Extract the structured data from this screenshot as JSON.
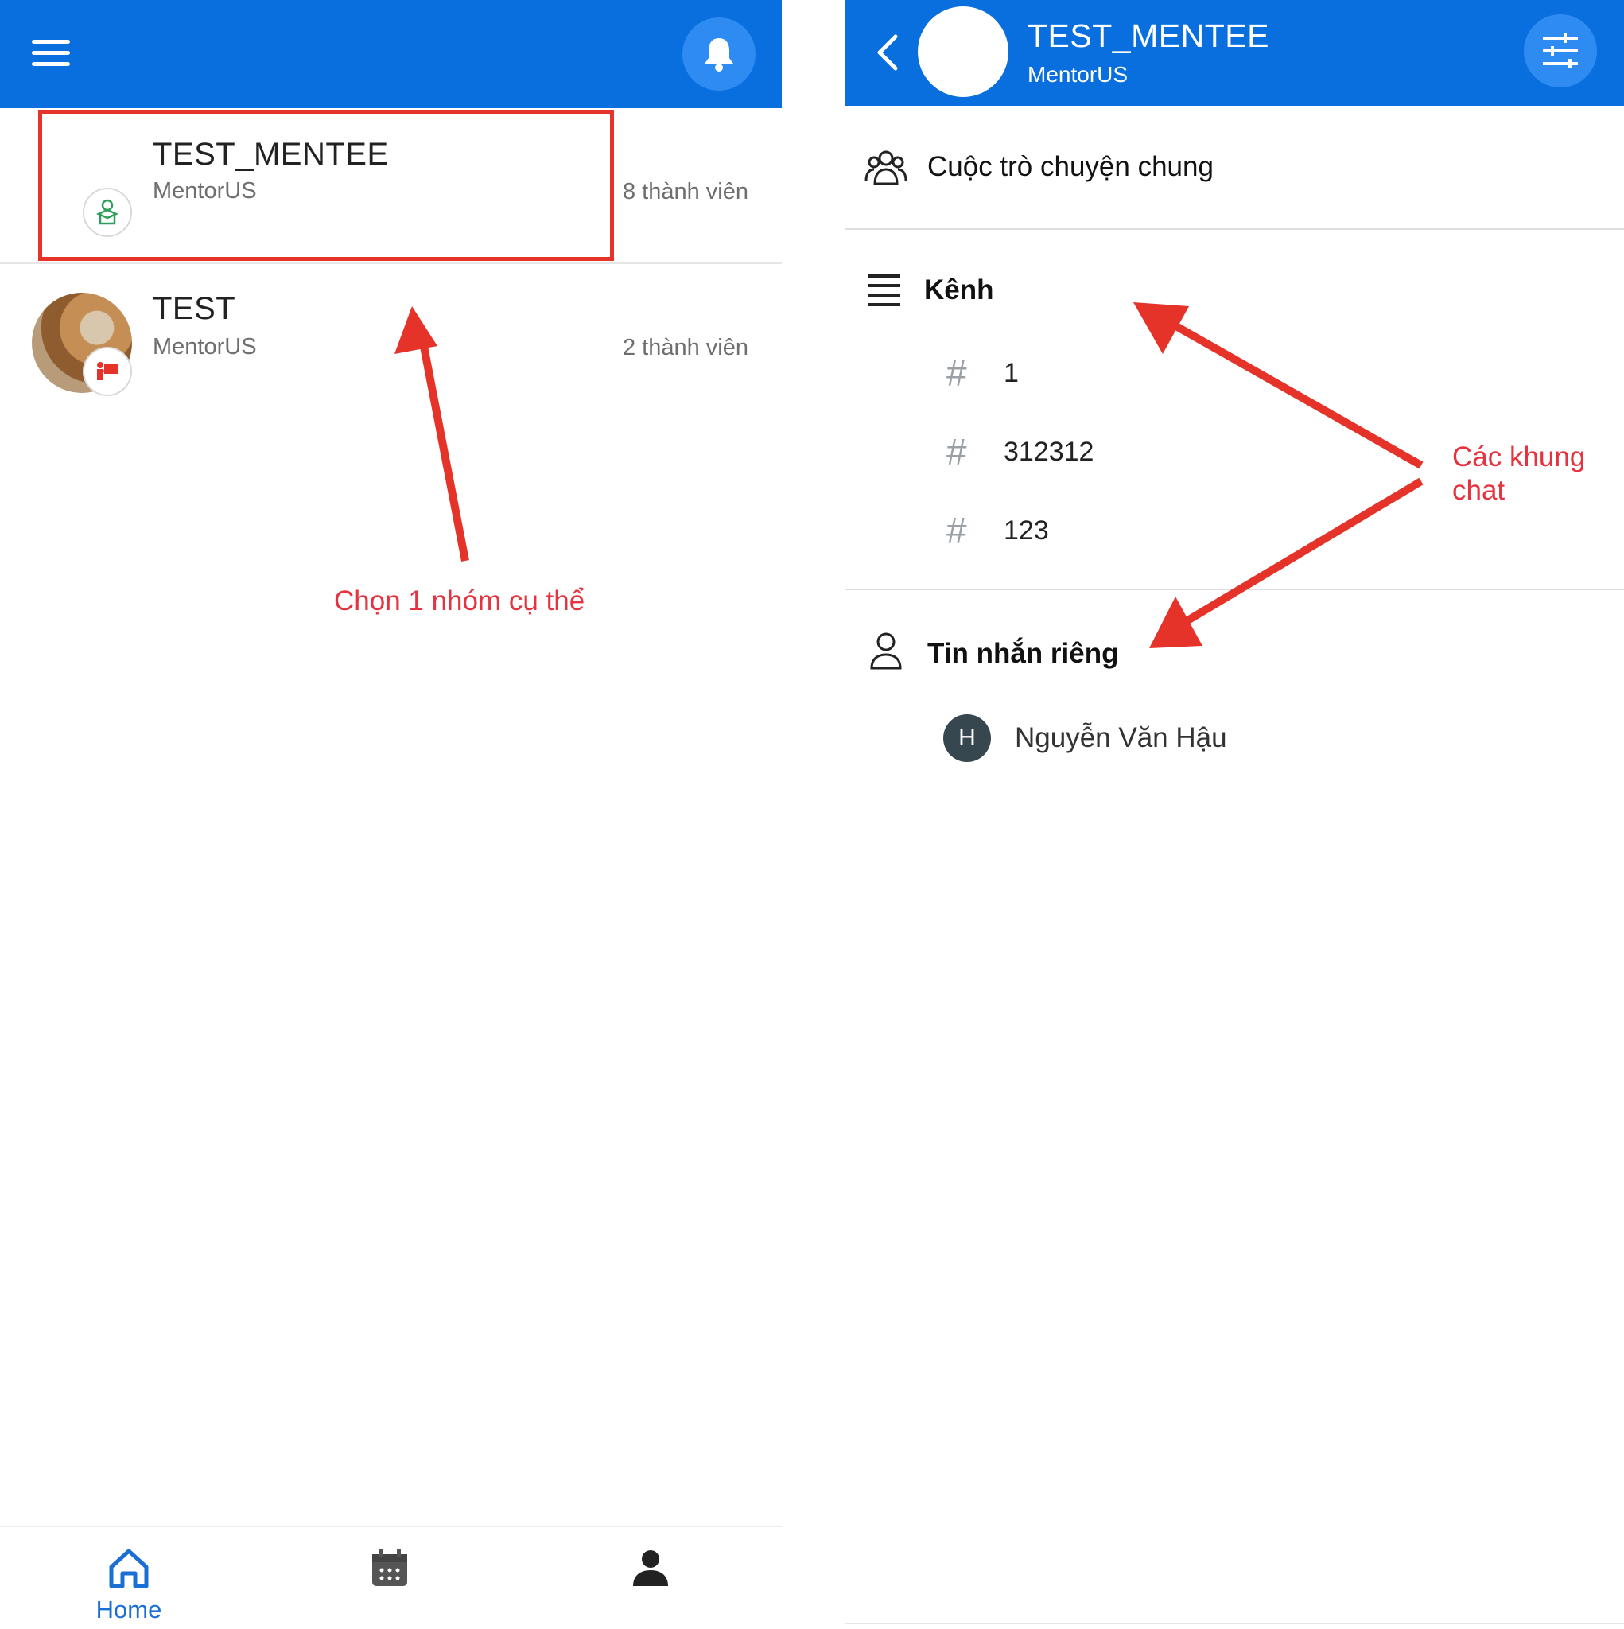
{
  "left_screen": {
    "groups": [
      {
        "name": "TEST_MENTEE",
        "org": "MentorUS",
        "members": "8 thành viên",
        "avatar_icon": "student-icon"
      },
      {
        "name": "TEST",
        "org": "MentorUS",
        "members": "2 thành viên",
        "avatar_icon": "teacher-icon"
      }
    ],
    "annotation": "Chọn 1 nhóm cụ thể",
    "bottom_nav": {
      "home_label": "Home"
    }
  },
  "right_screen": {
    "header": {
      "title": "TEST_MENTEE",
      "subtitle": "MentorUS"
    },
    "general_chat_label": "Cuộc trò chuyện chung",
    "channels_label": "Kênh",
    "channels": [
      {
        "hash": "#",
        "name": "1"
      },
      {
        "hash": "#",
        "name": "312312"
      },
      {
        "hash": "#",
        "name": "123"
      }
    ],
    "private_label": "Tin nhắn riêng",
    "private_messages": [
      {
        "initial": "H",
        "name": "Nguyễn Văn Hậu"
      }
    ],
    "annotation": "Các khung chat"
  },
  "colors": {
    "primary_blue": "#0a6fde",
    "annotation_red": "#e5333f",
    "highlight_red": "#e5332a"
  }
}
